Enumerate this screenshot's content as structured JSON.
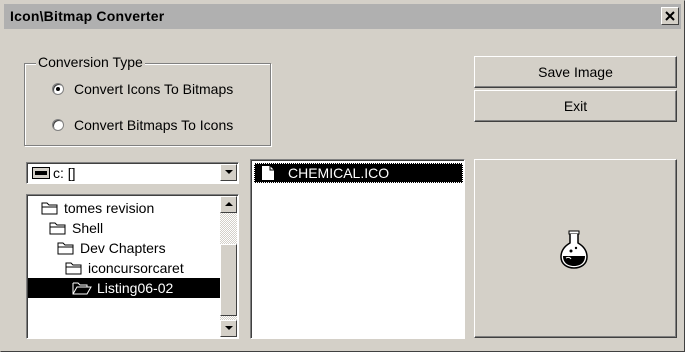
{
  "window": {
    "title": "Icon\\Bitmap Converter",
    "close_glyph": "x"
  },
  "conversion": {
    "group_label": "Conversion Type",
    "options": [
      {
        "label": "Convert Icons To Bitmaps",
        "checked": true
      },
      {
        "label": "Convert Bitmaps To Icons",
        "checked": false
      }
    ]
  },
  "buttons": {
    "save": "Save Image",
    "exit": "Exit"
  },
  "drive": {
    "value": "c: []",
    "icon": "drive-icon"
  },
  "folders": [
    {
      "label": "tomes revision",
      "icon": "folder-closed-icon",
      "selected": false
    },
    {
      "label": "Shell",
      "icon": "folder-closed-icon",
      "selected": false
    },
    {
      "label": "Dev Chapters",
      "icon": "folder-closed-icon",
      "selected": false
    },
    {
      "label": "iconcursorcaret",
      "icon": "folder-closed-icon",
      "selected": false
    },
    {
      "label": "Listing06-02",
      "icon": "folder-open-icon",
      "selected": true
    }
  ],
  "files": [
    {
      "label": "CHEMICAL.ICO",
      "icon": "file-icon",
      "selected": true
    }
  ],
  "preview": {
    "icon": "flask-icon"
  }
}
